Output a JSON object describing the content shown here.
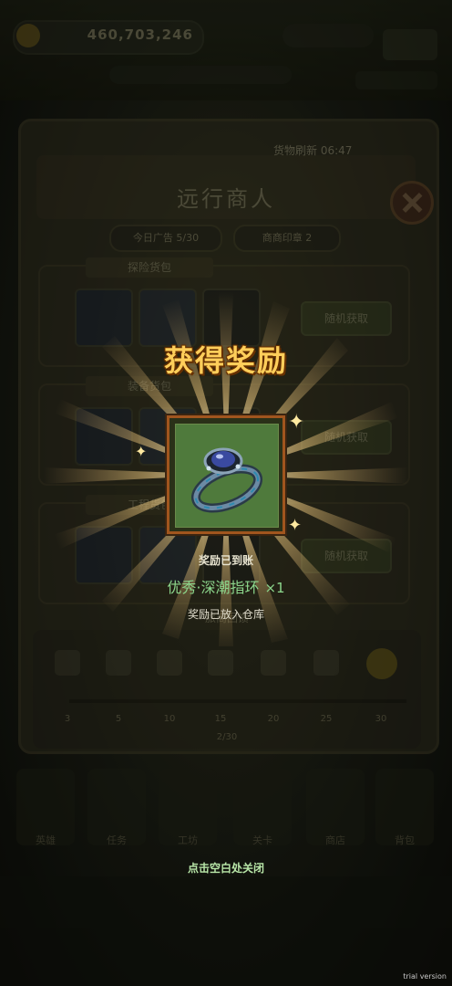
{
  "background": {
    "coin_value": "460,703,246",
    "shop_title": "远行商人",
    "refresh_timer": "货物刷新 06:47",
    "stats": {
      "ads_today": "今日广告 5/30",
      "merchant_seal": "商商印章 2"
    },
    "categories": [
      {
        "tab": "探险货包",
        "action": "随机获取"
      },
      {
        "tab": "装备货包",
        "action": "随机获取"
      },
      {
        "tab": "工程货包",
        "action": "随机获取"
      }
    ],
    "milestone": {
      "title": "旅商回馈",
      "steps": [
        "3",
        "5",
        "10",
        "15",
        "20",
        "25",
        "30"
      ],
      "progress": "2/30"
    },
    "nav_tabs": [
      "英雄",
      "任务",
      "工坊",
      "关卡",
      "商店",
      "背包"
    ]
  },
  "reward": {
    "title": "获得奖励",
    "account_label": "奖励已到账",
    "item_name": "优秀·深潮指环",
    "item_qty": "×1",
    "warehouse_label": "奖励已放入仓库",
    "close_hint": "点击空白处关闭"
  },
  "watermark": "trial version",
  "colors": {
    "title_gold": "#ffce5a",
    "item_name_green": "#8cd68c",
    "frame_border": "#a0551e",
    "frame_fill": "#4f7a3c"
  }
}
